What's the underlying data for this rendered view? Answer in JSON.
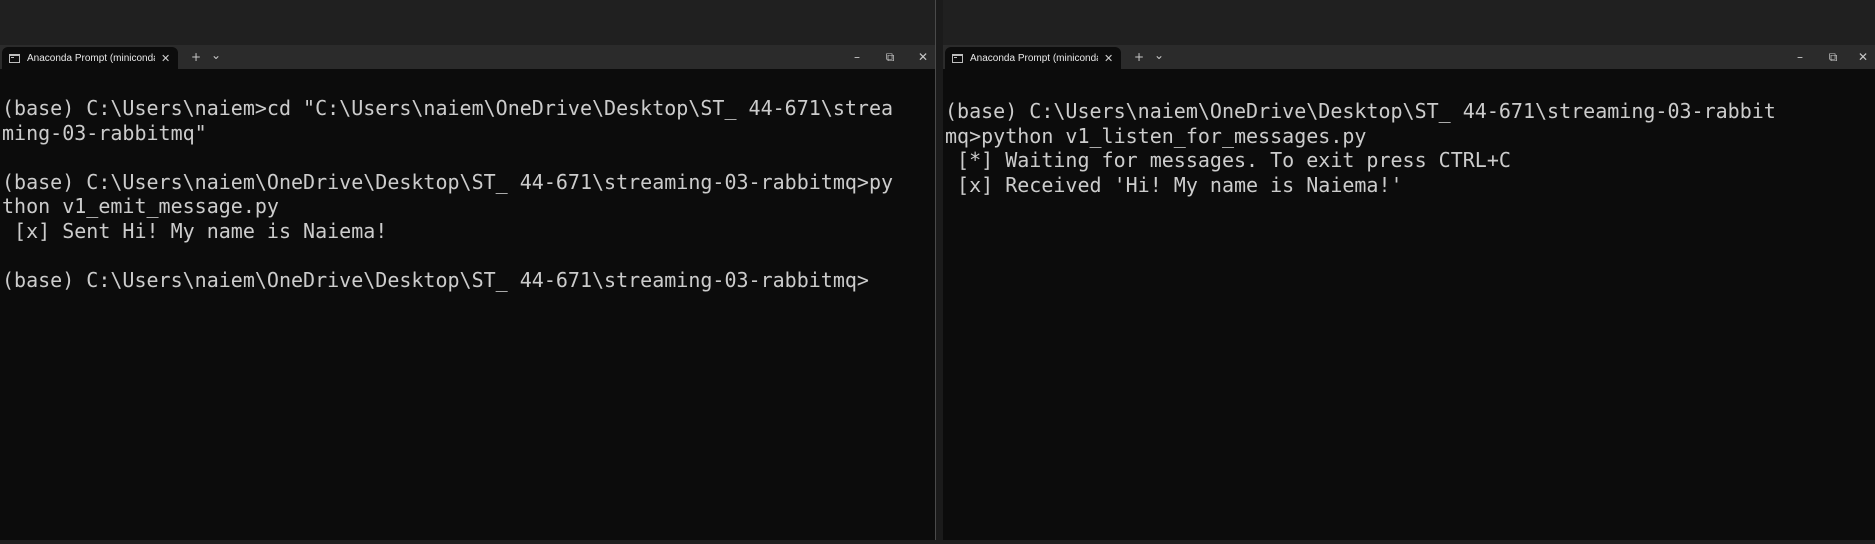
{
  "colors": {
    "terminal_bg": "#0c0c0c",
    "terminal_text": "#cccccc",
    "titlebar_bg": "#2b2b2b",
    "top_band_bg": "#202020"
  },
  "windows": [
    {
      "tab_title": "Anaconda Prompt (minicondа",
      "tab_icon": "terminal-icon",
      "buttons": {
        "new_tab": "+",
        "dropdown": "⌄",
        "minimize": "–",
        "maximize": "⧉",
        "close": "✕"
      },
      "lines": [
        "(base) C:\\Users\\naiem>cd \"C:\\Users\\naiem\\OneDrive\\Desktop\\ST_ 44-671\\strea",
        "ming-03-rabbitmq\"",
        "",
        "(base) C:\\Users\\naiem\\OneDrive\\Desktop\\ST_ 44-671\\streaming-03-rabbitmq>py",
        "thon v1_emit_message.py",
        " [x] Sent Hi! My name is Naiema!",
        "",
        "(base) C:\\Users\\naiem\\OneDrive\\Desktop\\ST_ 44-671\\streaming-03-rabbitmq>"
      ]
    },
    {
      "tab_title": "Anaconda Prompt (minicondа",
      "tab_icon": "terminal-icon",
      "buttons": {
        "new_tab": "+",
        "dropdown": "⌄",
        "minimize": "–",
        "maximize": "⧉",
        "close": "✕"
      },
      "lines": [
        "(base) C:\\Users\\naiem\\OneDrive\\Desktop\\ST_ 44-671\\streaming-03-rabbit",
        "mq>python v1_listen_for_messages.py",
        " [*] Waiting for messages. To exit press CTRL+C",
        " [x] Received 'Hi! My name is Naiema!'"
      ]
    }
  ]
}
